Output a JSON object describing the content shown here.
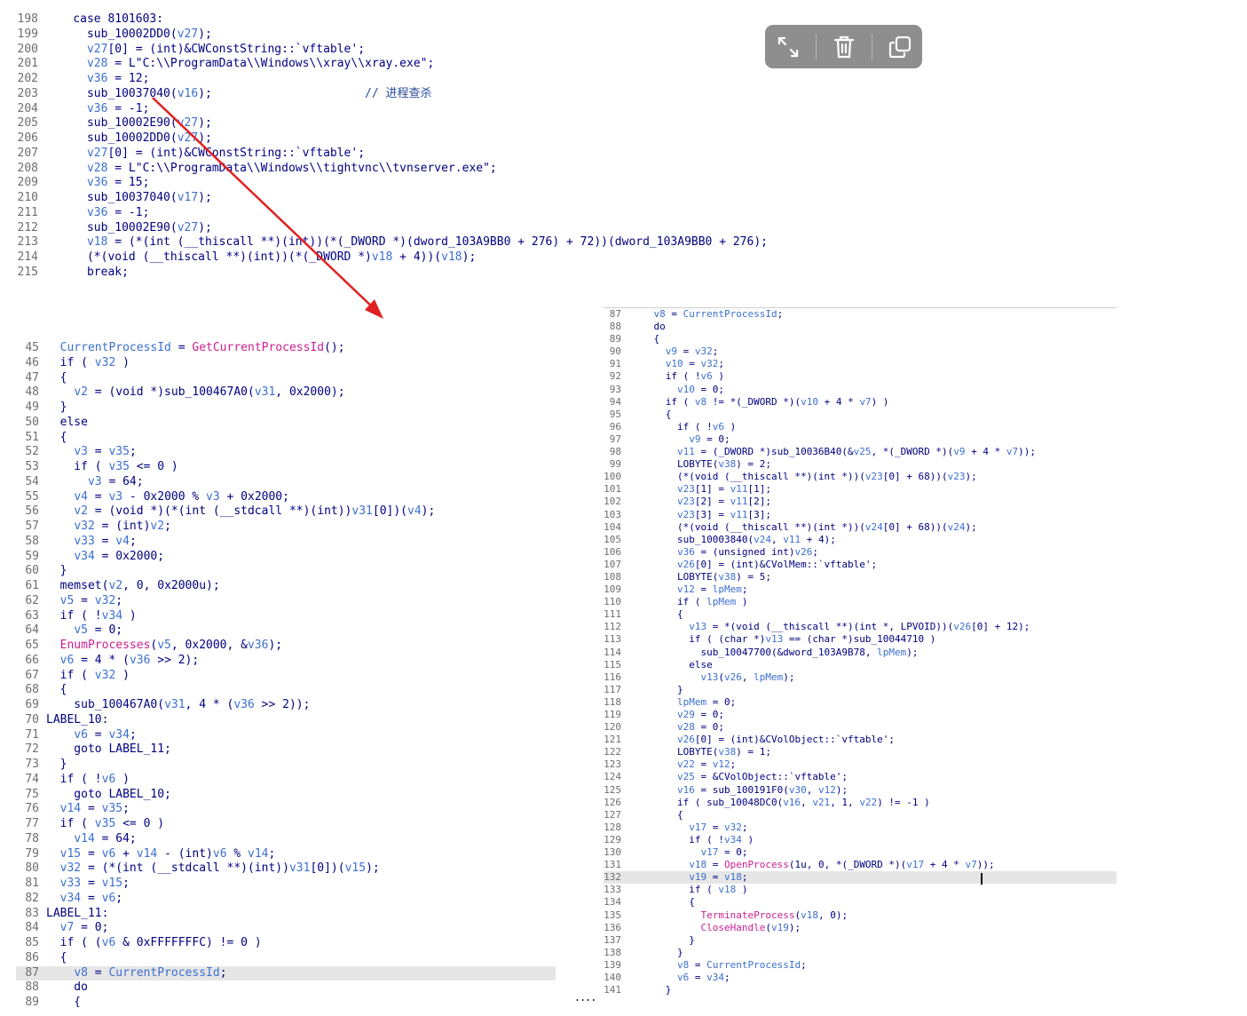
{
  "toolbar": {
    "buttons": [
      {
        "name": "expand-icon"
      },
      {
        "name": "trash-icon"
      },
      {
        "name": "copy-icon"
      }
    ]
  },
  "colors": {
    "arrow": "#e02020",
    "line_number": "#6e6e6e",
    "code": "#000080",
    "variable": "#3b6fd0",
    "function": "#cc1f8f",
    "highlight": "#e6e6e6"
  },
  "ellipsis": "....",
  "snippet1": {
    "lines": [
      {
        "n": "198",
        "t": "    case 8101603:"
      },
      {
        "n": "199",
        "t": "      sub_10002DD0(v27);"
      },
      {
        "n": "200",
        "t": "      v27[0] = (int)&CWConstString::`vftable';"
      },
      {
        "n": "201",
        "t": "      v28 = L\"C:\\\\ProgramData\\\\Windows\\\\xray\\\\xray.exe\";"
      },
      {
        "n": "202",
        "t": "      v36 = 12;"
      },
      {
        "n": "203",
        "t": "      sub_10037040(v16);                      // 进程查杀"
      },
      {
        "n": "204",
        "t": "      v36 = -1;"
      },
      {
        "n": "205",
        "t": "      sub_10002E90(v27);"
      },
      {
        "n": "206",
        "t": "      sub_10002DD0(v27);"
      },
      {
        "n": "207",
        "t": "      v27[0] = (int)&CWConstString::`vftable';"
      },
      {
        "n": "208",
        "t": "      v28 = L\"C:\\\\ProgramData\\\\Windows\\\\tightvnc\\\\tvnserver.exe\";"
      },
      {
        "n": "209",
        "t": "      v36 = 15;"
      },
      {
        "n": "210",
        "t": "      sub_10037040(v17);"
      },
      {
        "n": "211",
        "t": "      v36 = -1;"
      },
      {
        "n": "212",
        "t": "      sub_10002E90(v27);"
      },
      {
        "n": "213",
        "t": "      v18 = (*(int (__thiscall **)(int))(*(_DWORD *)(dword_103A9BB0 + 276) + 72))(dword_103A9BB0 + 276);"
      },
      {
        "n": "214",
        "t": "      (*(void (__thiscall **)(int))(*(_DWORD *)v18 + 4))(v18);"
      },
      {
        "n": "215",
        "t": "      break;"
      }
    ]
  },
  "snippet2": {
    "lines": [
      {
        "n": "45",
        "t": "  CurrentProcessId = GetCurrentProcessId();"
      },
      {
        "n": "46",
        "t": "  if ( v32 )"
      },
      {
        "n": "47",
        "t": "  {"
      },
      {
        "n": "48",
        "t": "    v2 = (void *)sub_100467A0(v31, 0x2000);"
      },
      {
        "n": "49",
        "t": "  }"
      },
      {
        "n": "50",
        "t": "  else"
      },
      {
        "n": "51",
        "t": "  {"
      },
      {
        "n": "52",
        "t": "    v3 = v35;"
      },
      {
        "n": "53",
        "t": "    if ( v35 <= 0 )"
      },
      {
        "n": "54",
        "t": "      v3 = 64;"
      },
      {
        "n": "55",
        "t": "    v4 = v3 - 0x2000 % v3 + 0x2000;"
      },
      {
        "n": "56",
        "t": "    v2 = (void *)(*(int (__stdcall **)(int))v31[0])(v4);"
      },
      {
        "n": "57",
        "t": "    v32 = (int)v2;"
      },
      {
        "n": "58",
        "t": "    v33 = v4;"
      },
      {
        "n": "59",
        "t": "    v34 = 0x2000;"
      },
      {
        "n": "60",
        "t": "  }"
      },
      {
        "n": "61",
        "t": "  memset(v2, 0, 0x2000u);"
      },
      {
        "n": "62",
        "t": "  v5 = v32;"
      },
      {
        "n": "63",
        "t": "  if ( !v34 )"
      },
      {
        "n": "64",
        "t": "    v5 = 0;"
      },
      {
        "n": "65",
        "t": "  EnumProcesses(v5, 0x2000, &v36);"
      },
      {
        "n": "66",
        "t": "  v6 = 4 * (v36 >> 2);"
      },
      {
        "n": "67",
        "t": "  if ( v32 )"
      },
      {
        "n": "68",
        "t": "  {"
      },
      {
        "n": "69",
        "t": "    sub_100467A0(v31, 4 * (v36 >> 2));"
      },
      {
        "n": "70",
        "t": "LABEL_10:"
      },
      {
        "n": "71",
        "t": "    v6 = v34;"
      },
      {
        "n": "72",
        "t": "    goto LABEL_11;"
      },
      {
        "n": "73",
        "t": "  }"
      },
      {
        "n": "74",
        "t": "  if ( !v6 )"
      },
      {
        "n": "75",
        "t": "    goto LABEL_10;"
      },
      {
        "n": "76",
        "t": "  v14 = v35;"
      },
      {
        "n": "77",
        "t": "  if ( v35 <= 0 )"
      },
      {
        "n": "78",
        "t": "    v14 = 64;"
      },
      {
        "n": "79",
        "t": "  v15 = v6 + v14 - (int)v6 % v14;"
      },
      {
        "n": "80",
        "t": "  v32 = (*(int (__stdcall **)(int))v31[0])(v15);"
      },
      {
        "n": "81",
        "t": "  v33 = v15;"
      },
      {
        "n": "82",
        "t": "  v34 = v6;"
      },
      {
        "n": "83",
        "t": "LABEL_11:"
      },
      {
        "n": "84",
        "t": "  v7 = 0;"
      },
      {
        "n": "85",
        "t": "  if ( (v6 & 0xFFFFFFFC) != 0 )"
      },
      {
        "n": "86",
        "t": "  {"
      },
      {
        "n": "87",
        "t": "    v8 = CurrentProcessId;"
      },
      {
        "n": "88",
        "t": "    do"
      },
      {
        "n": "89",
        "t": "    {"
      }
    ]
  },
  "snippet3": {
    "lines": [
      {
        "n": "87",
        "t": "    v8 = CurrentProcessId;"
      },
      {
        "n": "88",
        "t": "    do"
      },
      {
        "n": "89",
        "t": "    {"
      },
      {
        "n": "90",
        "t": "      v9 = v32;"
      },
      {
        "n": "91",
        "t": "      v10 = v32;"
      },
      {
        "n": "92",
        "t": "      if ( !v6 )"
      },
      {
        "n": "93",
        "t": "        v10 = 0;"
      },
      {
        "n": "94",
        "t": "      if ( v8 != *(_DWORD *)(v10 + 4 * v7) )"
      },
      {
        "n": "95",
        "t": "      {"
      },
      {
        "n": "96",
        "t": "        if ( !v6 )"
      },
      {
        "n": "97",
        "t": "          v9 = 0;"
      },
      {
        "n": "98",
        "t": "        v11 = (_DWORD *)sub_10036B40(&v25, *(_DWORD *)(v9 + 4 * v7));"
      },
      {
        "n": "99",
        "t": "        LOBYTE(v38) = 2;"
      },
      {
        "n": "100",
        "t": "        (*(void (__thiscall **)(int *))(v23[0] + 68))(v23);"
      },
      {
        "n": "101",
        "t": "        v23[1] = v11[1];"
      },
      {
        "n": "102",
        "t": "        v23[2] = v11[2];"
      },
      {
        "n": "103",
        "t": "        v23[3] = v11[3];"
      },
      {
        "n": "104",
        "t": "        (*(void (__thiscall **)(int *))(v24[0] + 68))(v24);"
      },
      {
        "n": "105",
        "t": "        sub_10003840(v24, v11 + 4);"
      },
      {
        "n": "106",
        "t": "        v36 = (unsigned int)v26;"
      },
      {
        "n": "107",
        "t": "        v26[0] = (int)&CVolMem::`vftable';"
      },
      {
        "n": "108",
        "t": "        LOBYTE(v38) = 5;"
      },
      {
        "n": "109",
        "t": "        v12 = lpMem;"
      },
      {
        "n": "110",
        "t": "        if ( lpMem )"
      },
      {
        "n": "111",
        "t": "        {"
      },
      {
        "n": "112",
        "t": "          v13 = *(void (__thiscall **)(int *, LPVOID))(v26[0] + 12);"
      },
      {
        "n": "113",
        "t": "          if ( (char *)v13 == (char *)sub_10044710 )"
      },
      {
        "n": "114",
        "t": "            sub_10047700(&dword_103A9B78, lpMem);"
      },
      {
        "n": "115",
        "t": "          else"
      },
      {
        "n": "116",
        "t": "            v13(v26, lpMem);"
      },
      {
        "n": "117",
        "t": "        }"
      },
      {
        "n": "118",
        "t": "        lpMem = 0;"
      },
      {
        "n": "119",
        "t": "        v29 = 0;"
      },
      {
        "n": "120",
        "t": "        v28 = 0;"
      },
      {
        "n": "121",
        "t": "        v26[0] = (int)&CVolObject::`vftable';"
      },
      {
        "n": "122",
        "t": "        LOBYTE(v38) = 1;"
      },
      {
        "n": "123",
        "t": "        v22 = v12;"
      },
      {
        "n": "124",
        "t": "        v25 = &CVolObject::`vftable';"
      },
      {
        "n": "125",
        "t": "        v16 = sub_100191F0(v30, v12);"
      },
      {
        "n": "126",
        "t": "        if ( sub_10048DC0(v16, v21, 1, v22) != -1 )"
      },
      {
        "n": "127",
        "t": "        {"
      },
      {
        "n": "128",
        "t": "          v17 = v32;"
      },
      {
        "n": "129",
        "t": "          if ( !v34 )"
      },
      {
        "n": "130",
        "t": "            v17 = 0;"
      },
      {
        "n": "131",
        "t": "          v18 = OpenProcess(1u, 0, *(_DWORD *)(v17 + 4 * v7));"
      },
      {
        "n": "132",
        "t": "          v19 = v18;"
      },
      {
        "n": "133",
        "t": "          if ( v18 )"
      },
      {
        "n": "134",
        "t": "          {"
      },
      {
        "n": "135",
        "t": "            TerminateProcess(v18, 0);"
      },
      {
        "n": "136",
        "t": "            CloseHandle(v19);"
      },
      {
        "n": "137",
        "t": "          }"
      },
      {
        "n": "138",
        "t": "        }"
      },
      {
        "n": "139",
        "t": "        v8 = CurrentProcessId;"
      },
      {
        "n": "140",
        "t": "        v6 = v34;"
      },
      {
        "n": "141",
        "t": "      }"
      }
    ]
  }
}
